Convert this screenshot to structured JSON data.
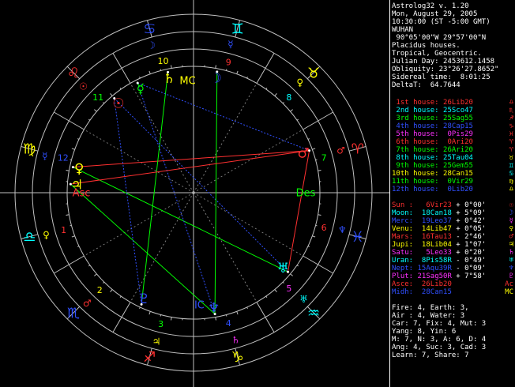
{
  "header": [
    "Astrolog32 v. 1.20",
    "Mon, August 29, 2005",
    "10:30:00 (ST -5:00 GMT)",
    "WUHAN",
    " 90°05'00\"W 29°57'00\"N",
    "Placidus houses.",
    "Tropical, Geocentric.",
    "Julian Day: 2453612.1458",
    "Obliquity: 23°26'27.8652\"",
    "Sidereal time:  8:01:25",
    "DeltaT:  64.7644"
  ],
  "houses": [
    {
      "label": "1st house:",
      "value": "26Lib20",
      "color": "#ff3030",
      "sym": "♎",
      "symColor": "#ff3030"
    },
    {
      "label": "2nd house:",
      "value": "25Sco47",
      "color": "#00ffff",
      "sym": "♏",
      "symColor": "#ff3030"
    },
    {
      "label": "3rd house:",
      "value": "25Sag55",
      "color": "#00ff00",
      "sym": "♐",
      "symColor": "#ff3030"
    },
    {
      "label": "4th house:",
      "value": "28Cap15",
      "color": "#3050ff",
      "sym": "♑",
      "symColor": "#ff3030"
    },
    {
      "label": "5th house:",
      "value": "0Pis29",
      "color": "#ff30ff",
      "sym": "♓",
      "symColor": "#ff3030"
    },
    {
      "label": "6th house:",
      "value": "0Ari20",
      "color": "#ff3030",
      "sym": "♈",
      "symColor": "#ff3030"
    },
    {
      "label": "7th house:",
      "value": "26Ari20",
      "color": "#00ff00",
      "sym": "♈",
      "symColor": "#ff3030"
    },
    {
      "label": "8th house:",
      "value": "25Tau04",
      "color": "#00ffff",
      "sym": "♉",
      "symColor": "#ffff00"
    },
    {
      "label": "9th house:",
      "value": "25Gem55",
      "color": "#00ff00",
      "sym": "♊",
      "symColor": "#00ffff"
    },
    {
      "label": "10th house:",
      "value": "28Can15",
      "color": "#ffff00",
      "sym": "♋",
      "symColor": "#00ffff"
    },
    {
      "label": "11th house:",
      "value": "0Vir29",
      "color": "#00ff00",
      "sym": "♍",
      "symColor": "#ffff00"
    },
    {
      "label": "12th house:",
      "value": "0Lib20",
      "color": "#3050ff",
      "sym": "♎",
      "symColor": "#ffff00"
    }
  ],
  "planets": [
    {
      "name": "Sun :",
      "pos": "6Vir23",
      "lat": "+ 0°00'",
      "color": "#ff3030",
      "sym": "☉",
      "symColor": "#ff3030"
    },
    {
      "name": "Moon:",
      "pos": "18Can18",
      "lat": "+ 5°09'",
      "color": "#00ffff",
      "sym": "☽",
      "symColor": "#3050ff"
    },
    {
      "name": "Merc:",
      "pos": "19Leo37",
      "lat": "+ 0°42'",
      "color": "#3050ff",
      "sym": "☿",
      "symColor": "#ff30ff"
    },
    {
      "name": "Venu:",
      "pos": "14Lib47",
      "lat": "+ 0°05'",
      "color": "#ffff00",
      "sym": "♀",
      "symColor": "#ffff00"
    },
    {
      "name": "Mars:",
      "pos": "16Tau13",
      "lat": "- 2°46'",
      "color": "#ff3030",
      "sym": "♂",
      "symColor": "#ff3030"
    },
    {
      "name": "Jupi:",
      "pos": "18Lib04",
      "lat": "+ 1°07'",
      "color": "#ffff00",
      "sym": "♃",
      "symColor": "#ffff00"
    },
    {
      "name": "Satu:",
      "pos": "5Leo33",
      "lat": "+ 0°20'",
      "color": "#ff30ff",
      "sym": "♄",
      "symColor": "#ff30ff"
    },
    {
      "name": "Uran:",
      "pos": "8Pis58R",
      "lat": "- 0°49'",
      "color": "#00ffff",
      "sym": "♅",
      "symColor": "#00ffff"
    },
    {
      "name": "Nept:",
      "pos": "15Aqu39R",
      "lat": "- 0°09'",
      "color": "#3050ff",
      "sym": "♆",
      "symColor": "#3050ff"
    },
    {
      "name": "Plut:",
      "pos": "21Sag50R",
      "lat": "+ 7°58'",
      "color": "#ff30ff",
      "sym": "♇",
      "symColor": "#ff30ff"
    },
    {
      "name": "Asce:",
      "pos": "26Lib20",
      "lat": "",
      "color": "#ff3030",
      "sym": "Ac",
      "symColor": "#ff3030"
    },
    {
      "name": "Midh:",
      "pos": "28Can15",
      "lat": "",
      "color": "#3050ff",
      "sym": "MC",
      "symColor": "#ffff00"
    }
  ],
  "stats": [
    "Fire: 4, Earth: 3,",
    "Air : 4, Water: 3",
    "Car: 7, Fix: 4, Mut: 3",
    "Yang: 8, Yin: 6",
    "M: 7, N: 3, A: 6, D: 4",
    "Ang: 4, Suc: 3, Cad: 3",
    "Learn: 7, Share: 7"
  ],
  "wheel": {
    "signs": [
      {
        "sym": "♎",
        "angle": 180,
        "color": "#00ffff"
      },
      {
        "sym": "♏",
        "angle": 210,
        "color": "#3050ff"
      },
      {
        "sym": "♐",
        "angle": 240,
        "color": "#ff3030"
      },
      {
        "sym": "♑",
        "angle": 270,
        "color": "#ffff00"
      },
      {
        "sym": "♒",
        "angle": 300,
        "color": "#00ffff"
      },
      {
        "sym": "♓",
        "angle": 330,
        "color": "#3050ff"
      },
      {
        "sym": "♈",
        "angle": 0,
        "color": "#ff3030"
      },
      {
        "sym": "♉",
        "angle": 30,
        "color": "#ffff00"
      },
      {
        "sym": "♊",
        "angle": 60,
        "color": "#00ffff"
      },
      {
        "sym": "♋",
        "angle": 90,
        "color": "#3050ff"
      },
      {
        "sym": "♌",
        "angle": 120,
        "color": "#ff3030"
      },
      {
        "sym": "♍",
        "angle": 150,
        "color": "#ffff00"
      }
    ],
    "rulers": [
      {
        "sym": "♀",
        "angle": 186,
        "color": "#ffff00"
      },
      {
        "sym": "♂",
        "angle": 216,
        "color": "#ff3030"
      },
      {
        "sym": "♃",
        "angle": 246,
        "color": "#ffff00"
      },
      {
        "sym": "♄",
        "angle": 276,
        "color": "#ff30ff"
      },
      {
        "sym": "♅",
        "angle": 306,
        "color": "#00ffff"
      },
      {
        "sym": "♆",
        "angle": 336,
        "color": "#3050ff"
      },
      {
        "sym": "♂",
        "angle": 6,
        "color": "#ff3030"
      },
      {
        "sym": "♀",
        "angle": 36,
        "color": "#ffff00"
      },
      {
        "sym": "☿",
        "angle": 66,
        "color": "#3050ff"
      },
      {
        "sym": "☽",
        "angle": 96,
        "color": "#3050ff"
      },
      {
        "sym": "☉",
        "angle": 126,
        "color": "#ff3030"
      },
      {
        "sym": "☿",
        "angle": 156,
        "color": "#3050ff"
      }
    ],
    "houseNumbers": [
      {
        "n": "1",
        "angle": 196,
        "color": "#ff3030"
      },
      {
        "n": "2",
        "angle": 226,
        "color": "#ffff00"
      },
      {
        "n": "3",
        "angle": 256,
        "color": "#00ff00"
      },
      {
        "n": "4",
        "angle": 285,
        "color": "#3050ff"
      },
      {
        "n": "5",
        "angle": 315,
        "color": "#ff30ff"
      },
      {
        "n": "6",
        "angle": 345,
        "color": "#ff3030"
      },
      {
        "n": "7",
        "angle": 15,
        "color": "#00ff00"
      },
      {
        "n": "8",
        "angle": 45,
        "color": "#00ffff"
      },
      {
        "n": "9",
        "angle": 75,
        "color": "#ff3030"
      },
      {
        "n": "10",
        "angle": 103,
        "color": "#ffff00"
      },
      {
        "n": "11",
        "angle": 135,
        "color": "#00ff00"
      },
      {
        "n": "12",
        "angle": 165,
        "color": "#3050ff"
      }
    ],
    "angles": [
      {
        "label": "Asc",
        "angle": 180,
        "color": "#ff3030"
      },
      {
        "label": "Des",
        "angle": 0,
        "color": "#00ff00"
      },
      {
        "label": "MC",
        "angle": 93,
        "color": "#ffff00"
      },
      {
        "label": "IC",
        "angle": 273,
        "color": "#3050ff"
      }
    ],
    "planets": [
      {
        "sym": "♀",
        "angle": 168,
        "color": "#ffff00"
      },
      {
        "sym": "♃",
        "angle": 176,
        "color": "#ffff00"
      },
      {
        "sym": "♂",
        "angle": 20,
        "color": "#ff3030"
      },
      {
        "sym": "♅",
        "angle": -40,
        "color": "#00ffff"
      },
      {
        "sym": "♆",
        "angle": -80,
        "color": "#3050ff"
      },
      {
        "sym": "♇",
        "angle": -115,
        "color": "#3050ff"
      },
      {
        "sym": "☉",
        "angle": 130,
        "color": "#ff3030"
      },
      {
        "sym": "☿",
        "angle": 117,
        "color": "#00ff00"
      },
      {
        "sym": "♄",
        "angle": 102,
        "color": "#ffff00"
      },
      {
        "sym": "☽",
        "angle": 79,
        "color": "#3050ff"
      }
    ]
  }
}
